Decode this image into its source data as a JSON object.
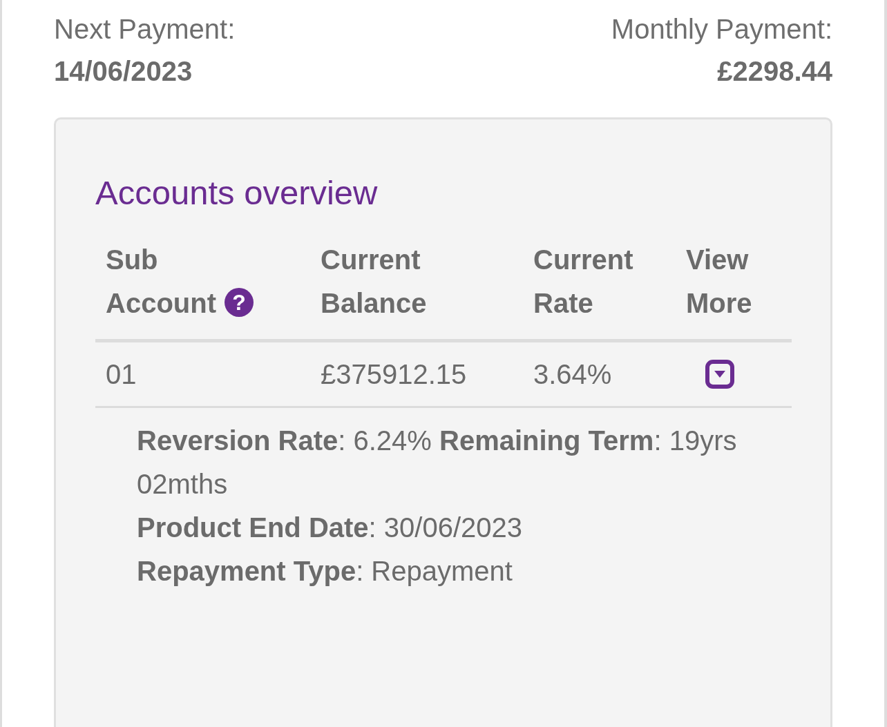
{
  "summary": [
    {
      "label": "Next Payment:",
      "value": "14/06/2023"
    },
    {
      "label": "Monthly Payment:",
      "value": "£2298.44"
    }
  ],
  "accounts": {
    "title": "Accounts overview",
    "columns": [
      {
        "line_1": "Sub",
        "line_2": "Account",
        "help": "?"
      },
      {
        "line_1": "Current",
        "line_2": "Balance"
      },
      {
        "line_1": "Current",
        "line_2": "Rate"
      },
      {
        "line_1": "View",
        "line_2": "More"
      }
    ],
    "rows": [
      {
        "sub_account": "01",
        "balance": "£375912.15",
        "rate": "3.64%",
        "expanded": true,
        "details": [
          "**Reversion Rate**: 6.24% **Remaining Term**: 19yrs 02mths",
          "**Product End Date**: 30/06/2023",
          "**Repayment Type**: Repayment"
        ]
      }
    ]
  }
}
